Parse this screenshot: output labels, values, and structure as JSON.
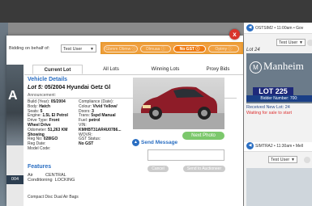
{
  "bidding": {
    "label": "Bidding on behalf of:",
    "user": "Test User",
    "options": [
      {
        "label": "Gbmm Obmw",
        "active": false
      },
      {
        "label": "Dlmuaa",
        "active": false
      },
      {
        "label": "No GST",
        "active": true
      },
      {
        "label": "Optmy",
        "active": false
      }
    ]
  },
  "close_label": "x",
  "tabs": [
    "Current Lot",
    "All Lots",
    "Winning Lots",
    "Proxy Bids"
  ],
  "left_strip": {
    "letter": "A",
    "dark_label": "004",
    "c_label": "Conditioning"
  },
  "vehicle": {
    "section_title": "Vehicle Details",
    "lot_prefix": "Lot 5:",
    "lot_title": "05/2004 Hyundai Getz Gl",
    "announcement": "Announcement:",
    "specs_left": [
      [
        "Build (Year): ",
        "05/2004"
      ],
      [
        "Body: ",
        "Hatch"
      ],
      [
        "Seats: ",
        "5"
      ],
      [
        "Engine: ",
        "1.5L El Petrol"
      ],
      [
        "Drive Type: ",
        "Front"
      ],
      [
        "",
        "Wheel Drive"
      ],
      [
        "Odometer: ",
        "51,263 KM"
      ],
      [
        "",
        "Showing"
      ],
      [
        "Reg No: ",
        "028IGO"
      ],
      [
        "Reg Date: ",
        ""
      ],
      [
        "Model Code: ",
        ""
      ]
    ],
    "specs_right": [
      [
        "Compliance (Date):",
        ""
      ],
      [
        "Colour: ",
        "Vivid Yellow/"
      ],
      [
        "Doors: ",
        "3"
      ],
      [
        "Trans: ",
        "5spd Manual"
      ],
      [
        "Fuel: ",
        "petrol"
      ],
      [
        "VIN: ",
        ""
      ],
      [
        "",
        "KMHBT31AR4U0786..."
      ],
      [
        "WOVR: ",
        ""
      ],
      [
        "GST Status: ",
        ""
      ],
      [
        "",
        "No GST"
      ],
      [
        "",
        ""
      ]
    ],
    "next_photo": "Next Photo"
  },
  "message": {
    "title": "Send Message",
    "cancel": "Cancel",
    "send": "Send to Auctioneer"
  },
  "features": {
    "title": "Features",
    "items": [
      "Air          CENTRAL",
      "Conditioning  LOCKING"
    ],
    "compact": "Compact Disc Dual Air Bags"
  },
  "right_panel": {
    "stream1": {
      "title": "OSTSIM2 • 11:00am • Gov",
      "user": "Test User",
      "lot_label": "Lot 24",
      "logo": "Manheim",
      "lot_board": "LOT 225",
      "bidder": "Bidder Number: 700:",
      "status1": "Received New Lot: 24",
      "status2": "Waiting for sale to start"
    },
    "stream2": {
      "title": "SIMTRA2 • 11:30am • Mell",
      "user": "Test User"
    }
  },
  "colors": {
    "accent": "#2a6ec2",
    "orange": "#f0a040",
    "green": "#7cc86c",
    "red": "#d9342b"
  }
}
